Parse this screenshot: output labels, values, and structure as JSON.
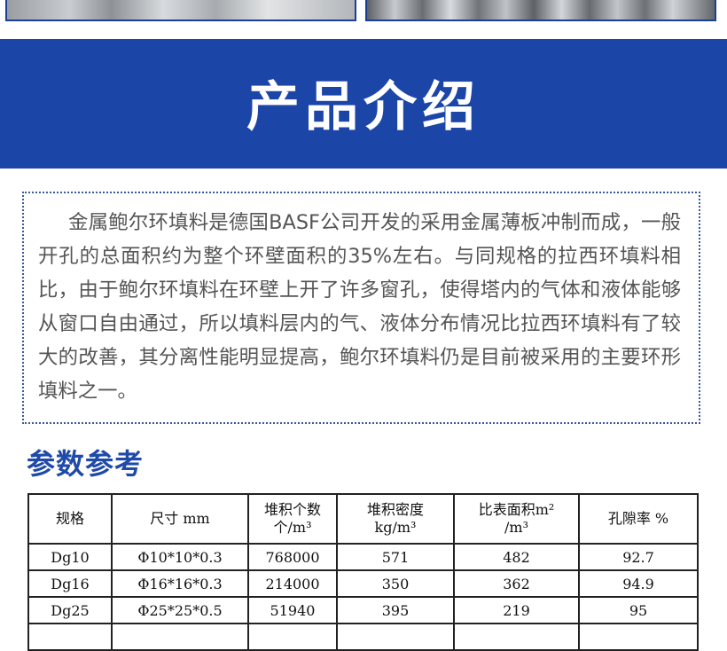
{
  "hero": {
    "title": "产品介绍"
  },
  "intro": {
    "text": "金属鲍尔环填料是德国BASF公司开发的采用金属薄板冲制而成，一般开孔的总面积约为整个环壁面积的35%左右。与同规格的拉西环填料相比，由于鲍尔环填料在环壁上开了许多窗孔，使得塔内的气体和液体能够从窗口自由通过，所以填料层内的气、液体分布情况比拉西环填料有了较大的改善，其分离性能明显提高，鲍尔环填料仍是目前被采用的主要环形填料之一。"
  },
  "params": {
    "title": "参数参考",
    "headers": [
      [
        "规格"
      ],
      [
        "尺寸 mm"
      ],
      [
        "堆积个数",
        "个/m³"
      ],
      [
        "堆积密度",
        "kg/m³"
      ],
      [
        "比表面积m²",
        "/m³"
      ],
      [
        "孔隙率 %"
      ]
    ],
    "rows": [
      [
        "Dg10",
        "Φ10*10*0.3",
        "768000",
        "571",
        "482",
        "92.7"
      ],
      [
        "Dg16",
        "Φ16*16*0.3",
        "214000",
        "350",
        "362",
        "94.9"
      ],
      [
        "Dg25",
        "Φ25*25*0.5",
        "51940",
        "395",
        "219",
        "95"
      ]
    ]
  }
}
